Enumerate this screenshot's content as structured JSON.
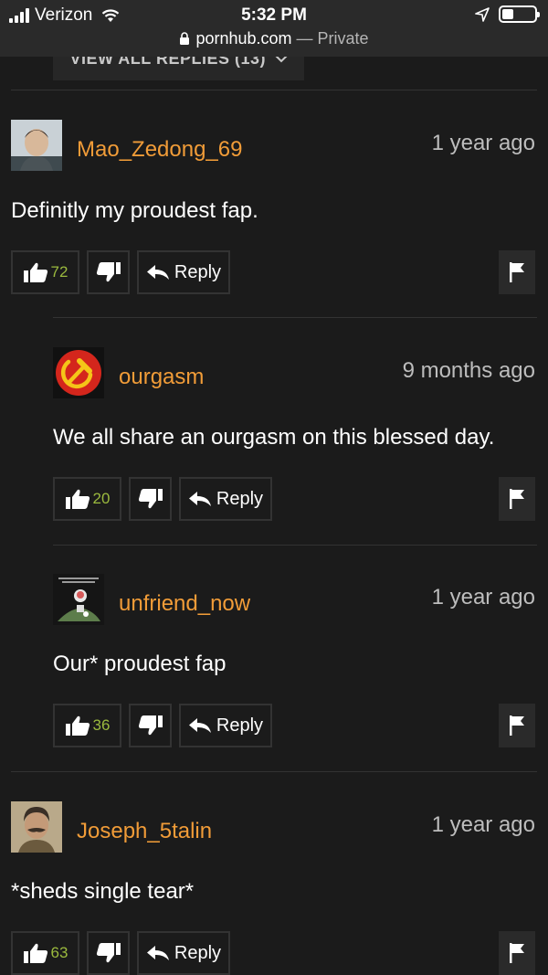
{
  "statusbar": {
    "carrier": "Verizon",
    "time": "5:32 PM",
    "url": "pornhub.com",
    "url_separator": " — ",
    "mode": "Private"
  },
  "view_all_replies": "VIEW ALL REPLIES (13)",
  "comments": [
    {
      "username": "Mao_Zedong_69",
      "time": "1 year ago",
      "text": "Definitly my proudest fap.",
      "likes": "72",
      "reply_label": "Reply",
      "avatar_icon": "portrait-avatar"
    },
    {
      "username": "ourgasm",
      "time": "9 months ago",
      "text": "We all share an ourgasm on this blessed day.",
      "likes": "20",
      "reply_label": "Reply",
      "avatar_icon": "hammer-sickle-avatar"
    },
    {
      "username": "unfriend_now",
      "time": "1 year ago",
      "text": "Our* proudest fap",
      "likes": "36",
      "reply_label": "Reply",
      "avatar_icon": "meme-avatar"
    },
    {
      "username": "Joseph_5talin",
      "time": "1 year ago",
      "text": "*sheds single tear*",
      "likes": "63",
      "reply_label": "Reply",
      "avatar_icon": "portrait-avatar"
    }
  ],
  "colors": {
    "background": "#1b1b1b",
    "username": "#f19c38",
    "like_count": "#9bba3e",
    "muted": "#bdbdbd",
    "communist_red": "#d4261c"
  }
}
